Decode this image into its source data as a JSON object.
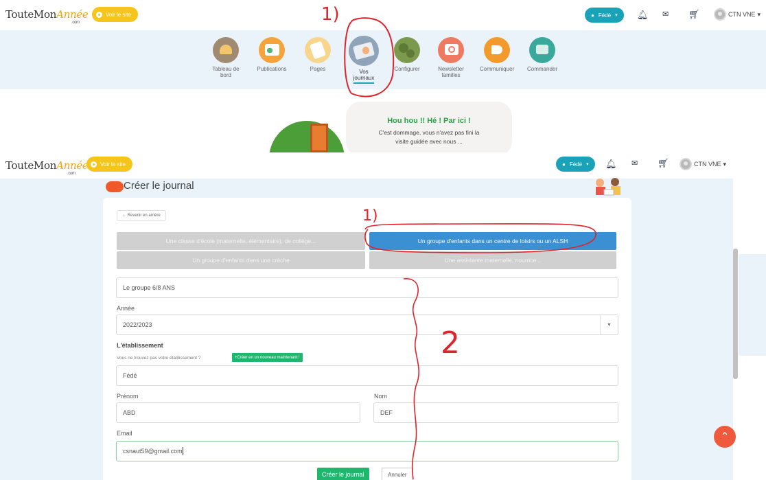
{
  "shot1": {
    "logo": {
      "part1": "TouteMon",
      "part2": "Année",
      "sub": ".com"
    },
    "visit_site": "Voir le site",
    "account_menu": "Fédé",
    "user_name": "CTN VNE",
    "nav": [
      {
        "line1": "Tableau de",
        "line2": "bord",
        "icon": "dashboard-icon"
      },
      {
        "line1": "Publications",
        "line2": "",
        "icon": "publications-icon"
      },
      {
        "line1": "Pages",
        "line2": "",
        "icon": "pages-icon"
      },
      {
        "line1": "Vos",
        "line2": "journaux",
        "icon": "journals-icon"
      },
      {
        "line1": "Configurer",
        "line2": "",
        "icon": "gears-icon"
      },
      {
        "line1": "Newsletter",
        "line2": "familles",
        "icon": "newsletter-icon"
      },
      {
        "line1": "Communiquer",
        "line2": "",
        "icon": "megaphone-icon"
      },
      {
        "line1": "Commander",
        "line2": "",
        "icon": "cart-icon"
      }
    ],
    "guide": {
      "title": "Hou hou !! Hé ! Par ici !",
      "line1": "C'est dommage, vous n'avez pas fini la",
      "line2": "visite guidée avec nous ..."
    },
    "annotation": "1)"
  },
  "shot2": {
    "logo": {
      "part1": "TouteMon",
      "part2": "Année",
      "sub": ".com"
    },
    "visit_site": "Voir le site",
    "account_menu": "Fédé",
    "user_name": "CTN VNE",
    "page_title": "Créer le journal",
    "back": "Revenir en arrière",
    "choices": [
      "Une classe d'école (maternelle, élémentaire), de collège...",
      "Un groupe d'enfants dans un centre de loisirs ou un ALSH",
      "Un groupe d'enfants dans une crèche",
      "Une assistante maternelle, nourrice..."
    ],
    "group_name": "Le groupe 6/8 ANS",
    "year_label": "Année",
    "year_value": "2022/2023",
    "establishment_label": "L'établissement",
    "establishment_hint": "Vous ne trouvez pas votre établissement ?",
    "create_establishment": "Créer en un nouveau maintenant !",
    "establishment_value": "Fédé",
    "firstname_label": "Prénom",
    "firstname_value": "ABD",
    "lastname_label": "Nom",
    "lastname_value": "DEF",
    "email_label": "Email",
    "email_value": "csnaut59@gmail.com",
    "submit": "Créer le journal",
    "cancel": "Annuler",
    "annotation_1": "1)",
    "annotation_2": "2"
  },
  "colors": {
    "accent": "#1aa2b9",
    "selected_choice": "#3b8fd3",
    "green": "#1fb66e",
    "visit": "#f6c51c",
    "annotation": "#e0232a"
  }
}
